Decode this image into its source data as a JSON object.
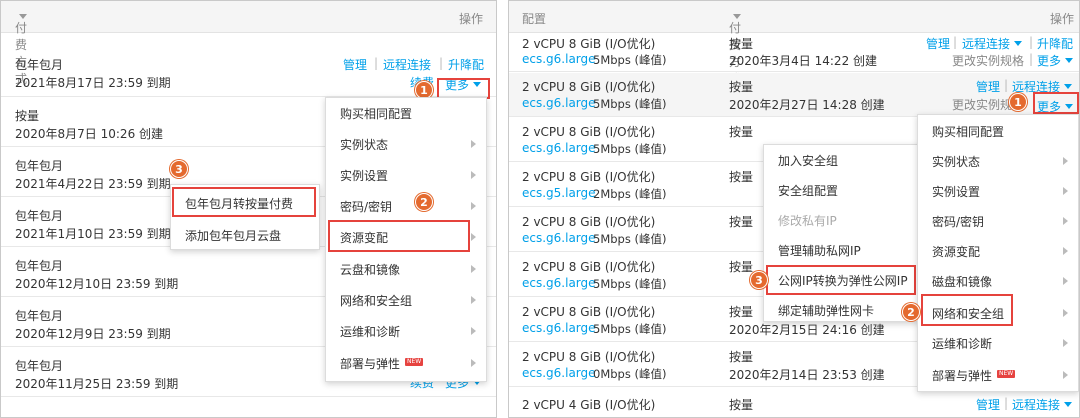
{
  "left": {
    "header": {
      "billing_col": "付费方式",
      "ops_col": "操作"
    },
    "top_row": {
      "type": "包年包月",
      "date": "2021年8月17日 23:59 到期",
      "links": [
        "管理",
        "远程连接",
        "升降配"
      ],
      "renew": "续费",
      "more": "更多"
    },
    "rows": [
      {
        "type": "按量",
        "date": "2020年8月7日 10:26 创建"
      },
      {
        "type": "包年包月",
        "date": "2021年4月22日 23:59 到期"
      },
      {
        "type": "包年包月",
        "date": "2021年1月10日 23:59 到期"
      },
      {
        "type": "包年包月",
        "date": "2020年12月10日 23:59 到期"
      },
      {
        "type": "包年包月",
        "date": "2020年12月9日 23:59 到期"
      },
      {
        "type": "包年包月",
        "date": "2020年11月25日 23:59 到期"
      }
    ],
    "bottom_links": [
      "续费",
      "更多"
    ],
    "menu": {
      "items": [
        "购买相同配置",
        "实例状态",
        "实例设置",
        "密码/密钥",
        "资源变配",
        "云盘和镜像",
        "网络和安全组",
        "运维和诊断",
        "部署与弹性"
      ],
      "new_badge": "NEW"
    },
    "submenu": {
      "items": [
        "包年包月转按量付费",
        "添加包年包月云盘"
      ]
    },
    "step_badges": [
      "1",
      "2",
      "3"
    ]
  },
  "right": {
    "header": {
      "config_col": "配置",
      "billing_col": "付费方式",
      "ops_col": "操作"
    },
    "rows": [
      {
        "spec": "2 vCPU 8 GiB (I/O优化)",
        "model": "ecs.g6.large",
        "bw": "5Mbps (峰值)",
        "type": "按量",
        "date": "2020年3月4日 14:22 创建"
      },
      {
        "spec": "2 vCPU 8 GiB (I/O优化)",
        "model": "ecs.g6.large",
        "bw": "5Mbps (峰值)",
        "type": "按量",
        "date": "2020年2月27日 14:28 创建"
      },
      {
        "spec": "2 vCPU 8 GiB (I/O优化)",
        "model": "ecs.g6.large",
        "bw": "5Mbps (峰值)",
        "type": "按量",
        "date": ""
      },
      {
        "spec": "2 vCPU 8 GiB (I/O优化)",
        "model": "ecs.g5.large",
        "bw": "2Mbps (峰值)",
        "type": "按量",
        "date": ""
      },
      {
        "spec": "2 vCPU 8 GiB (I/O优化)",
        "model": "ecs.g6.large",
        "bw": "5Mbps (峰值)",
        "type": "按量",
        "date": ""
      },
      {
        "spec": "2 vCPU 8 GiB (I/O优化)",
        "model": "ecs.g6.large",
        "bw": "5Mbps (峰值)",
        "type": "按量",
        "date": ""
      },
      {
        "spec": "2 vCPU 8 GiB (I/O优化)",
        "model": "ecs.g6.large",
        "bw": "5Mbps (峰值)",
        "type": "按量",
        "date": "2020年2月15日 24:16 创建"
      },
      {
        "spec": "2 vCPU 8 GiB (I/O优化)",
        "model": "ecs.g6.large",
        "bw": "0Mbps (峰值)",
        "type": "按量",
        "date": "2020年2月14日 23:53 创建"
      },
      {
        "spec": "2 vCPU 4 GiB (I/O优化)",
        "model": "",
        "bw": "",
        "type": "按量",
        "date": ""
      }
    ],
    "row_links": {
      "manage": "管理",
      "remote": "远程连接",
      "upgrade": "升降配",
      "change_spec": "更改实例规格",
      "more": "更多"
    },
    "menu": {
      "items": [
        "购买相同配置",
        "实例状态",
        "实例设置",
        "密码/密钥",
        "资源变配",
        "磁盘和镜像",
        "网络和安全组",
        "运维和诊断",
        "部署与弹性"
      ],
      "new_badge": "NEW"
    },
    "submenu": {
      "items": [
        "加入安全组",
        "安全组配置",
        "修改私有IP",
        "管理辅助私网IP",
        "公网IP转换为弹性公网IP",
        "绑定辅助弹性网卡"
      ]
    },
    "step_badges": [
      "1",
      "2",
      "3"
    ]
  }
}
